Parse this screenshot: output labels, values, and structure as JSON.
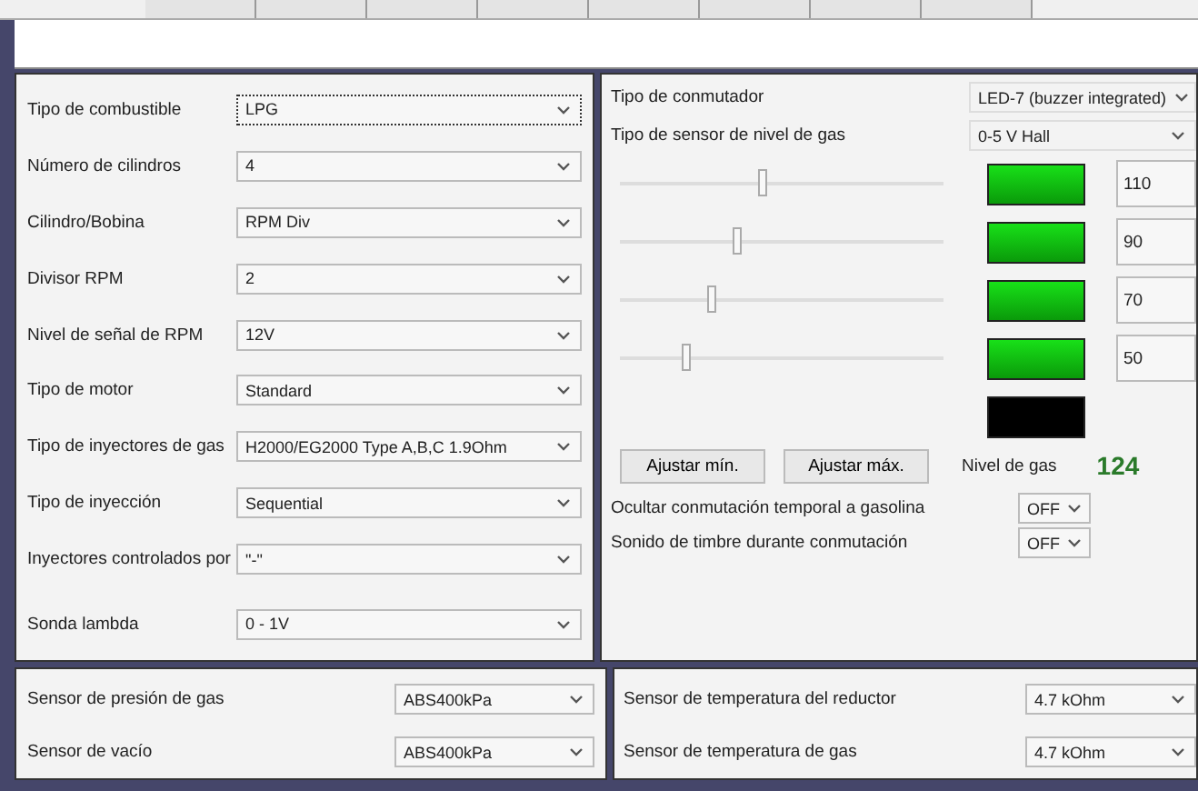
{
  "left_panel": {
    "rows": [
      {
        "label": "Tipo de combustible",
        "value": "LPG",
        "focused": true
      },
      {
        "label": "Número de cilindros",
        "value": "4",
        "focused": false
      },
      {
        "label": "Cilindro/Bobina",
        "value": "RPM Div",
        "focused": false
      },
      {
        "label": "Divisor RPM",
        "value": "2",
        "focused": false
      },
      {
        "label": "Nivel de señal de RPM",
        "value": "12V",
        "focused": false
      },
      {
        "label": "Tipo de motor",
        "value": "Standard",
        "focused": false
      },
      {
        "label": "Tipo de inyectores de gas",
        "value": "H2000/EG2000 Type A,B,C 1.9Ohm",
        "focused": false
      },
      {
        "label": "Tipo de inyección",
        "value": "Sequential",
        "focused": false
      },
      {
        "label": "Inyectores controlados por",
        "value": "\"-\"",
        "focused": false
      },
      {
        "label": "Sonda lambda",
        "value": "0 - 1V",
        "focused": false
      }
    ]
  },
  "right_panel": {
    "selects": [
      {
        "label": "Tipo de conmutador",
        "value": "LED-7 (buzzer integrated)"
      },
      {
        "label": "Tipo de sensor de nivel de gas",
        "value": "0-5 V Hall"
      }
    ],
    "level_rows": [
      {
        "level": 0.44,
        "on": true,
        "value": "110"
      },
      {
        "level": 0.36,
        "on": true,
        "value": "90"
      },
      {
        "level": 0.28,
        "on": true,
        "value": "70"
      },
      {
        "level": 0.2,
        "on": true,
        "value": "50"
      }
    ],
    "reserve_led": {
      "on": false
    },
    "buttons": [
      "Ajustar mín.",
      "Ajustar máx."
    ],
    "gas_level": {
      "label": "Nivel de gas",
      "value": "124"
    },
    "toggles": [
      {
        "label": "Ocultar conmutación temporal a gasolina",
        "value": "OFF"
      },
      {
        "label": "Sonido de timbre durante conmutación",
        "value": "OFF"
      }
    ]
  },
  "bottom_left": {
    "rows": [
      {
        "label": "Sensor de presión de gas",
        "value": "ABS400kPa"
      },
      {
        "label": "Sensor de vacío",
        "value": "ABS400kPa"
      }
    ]
  },
  "bottom_right": {
    "rows": [
      {
        "label": "Sensor de temperatura del reductor",
        "value": "4.7 kOhm"
      },
      {
        "label": "Sensor de temperatura de gas",
        "value": "4.7 kOhm"
      }
    ]
  }
}
